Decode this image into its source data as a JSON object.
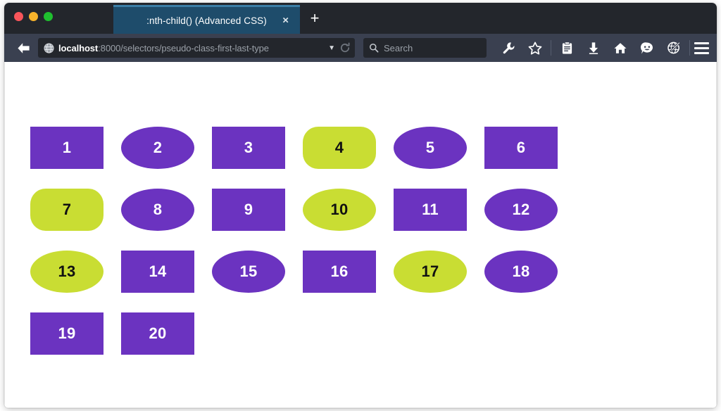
{
  "window": {
    "traffic_lights": [
      {
        "name": "close",
        "color": "#f9555a"
      },
      {
        "name": "minimize",
        "color": "#f8b32b"
      },
      {
        "name": "maximize",
        "color": "#1fbf2f"
      }
    ]
  },
  "tabs": {
    "active": {
      "title": ":nth-child() (Advanced CSS)",
      "close_label": "×"
    },
    "new_tab_label": "+"
  },
  "toolbar": {
    "back_icon": "back-arrow-icon",
    "url": {
      "host": "localhost",
      "path": ":8000/selectors/pseudo-class-first-last-type",
      "favicon": "globe-icon",
      "dropdown_label": "▼",
      "reload_icon": "reload-icon"
    },
    "search": {
      "placeholder": "Search",
      "icon": "search-icon"
    },
    "icons": [
      {
        "name": "wrench-icon",
        "label": "Developer Tools"
      },
      {
        "name": "star-icon",
        "label": "Bookmark"
      },
      {
        "name": "reader-list-icon",
        "label": "Reading List"
      },
      {
        "name": "download-icon",
        "label": "Downloads"
      },
      {
        "name": "home-icon",
        "label": "Home"
      },
      {
        "name": "smiley-feedback-icon",
        "label": "Feedback"
      },
      {
        "name": "globe-pencil-icon",
        "label": "Web Developer"
      }
    ],
    "menu_icon": "hamburger-menu-icon"
  },
  "colors": {
    "purple": "#6b33c0",
    "lime": "#c9dd33",
    "toolbar_bg": "#3a4050",
    "titlebar_bg": "#23262c",
    "tab_bg": "#1e4c6b",
    "tab_border": "#3b7ea6",
    "page_bg": "#ffffff"
  },
  "page": {
    "boxes": [
      {
        "label": "1",
        "color": "purple",
        "shape": "square"
      },
      {
        "label": "2",
        "color": "purple",
        "shape": "pill"
      },
      {
        "label": "3",
        "color": "purple",
        "shape": "square"
      },
      {
        "label": "4",
        "color": "lime",
        "shape": "round"
      },
      {
        "label": "5",
        "color": "purple",
        "shape": "pill"
      },
      {
        "label": "6",
        "color": "purple",
        "shape": "square"
      },
      {
        "label": "7",
        "color": "lime",
        "shape": "round"
      },
      {
        "label": "8",
        "color": "purple",
        "shape": "pill"
      },
      {
        "label": "9",
        "color": "purple",
        "shape": "square"
      },
      {
        "label": "10",
        "color": "lime",
        "shape": "pill"
      },
      {
        "label": "11",
        "color": "purple",
        "shape": "square"
      },
      {
        "label": "12",
        "color": "purple",
        "shape": "pill"
      },
      {
        "label": "13",
        "color": "lime",
        "shape": "pill"
      },
      {
        "label": "14",
        "color": "purple",
        "shape": "square"
      },
      {
        "label": "15",
        "color": "purple",
        "shape": "pill"
      },
      {
        "label": "16",
        "color": "purple",
        "shape": "square"
      },
      {
        "label": "17",
        "color": "lime",
        "shape": "pill"
      },
      {
        "label": "18",
        "color": "purple",
        "shape": "pill"
      },
      {
        "label": "19",
        "color": "purple",
        "shape": "square"
      },
      {
        "label": "20",
        "color": "purple",
        "shape": "square"
      }
    ]
  }
}
